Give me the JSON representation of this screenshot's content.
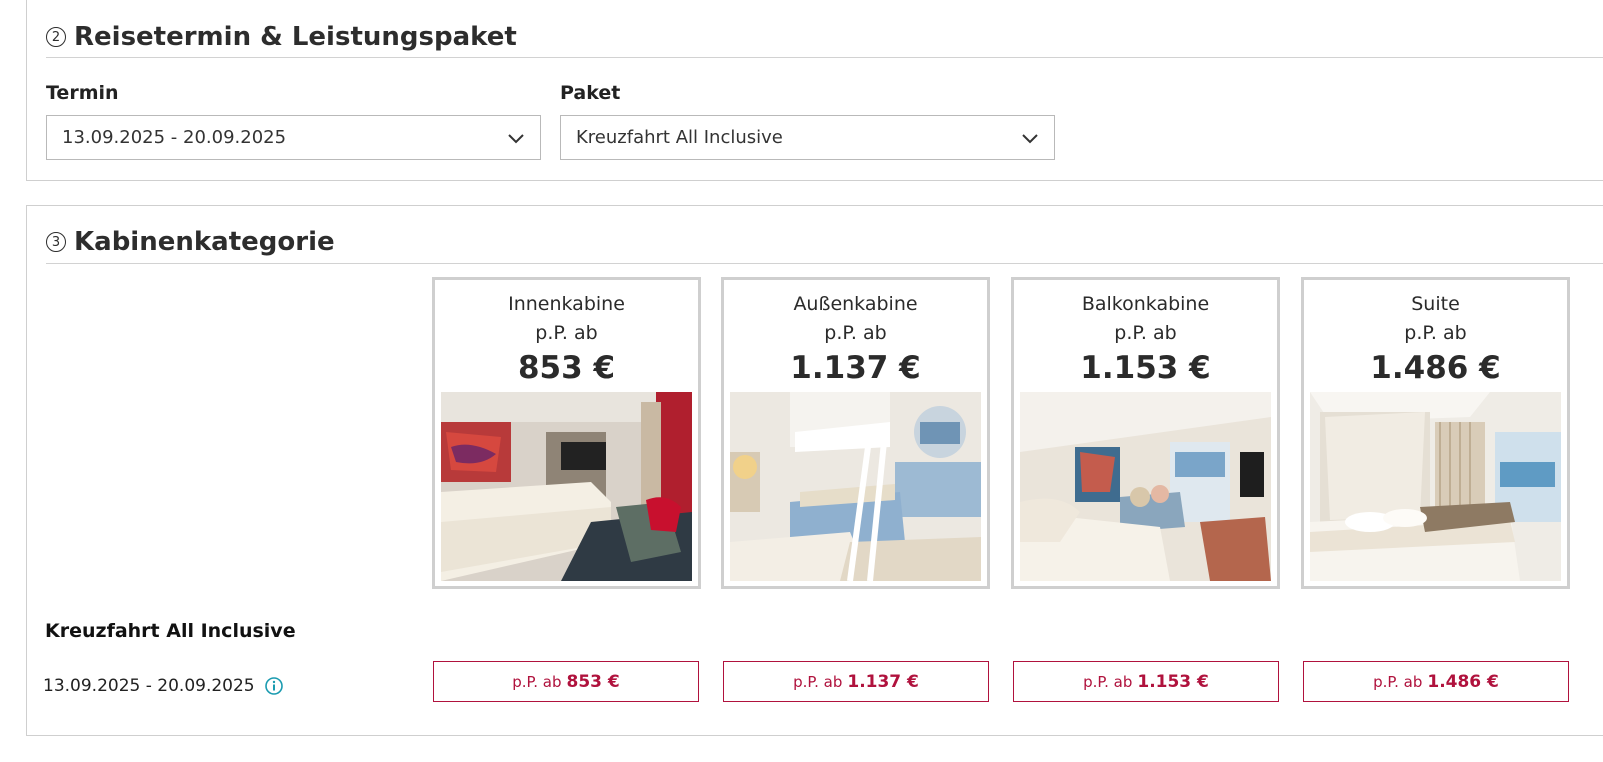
{
  "travel_section": {
    "number": "2",
    "title": "Reisetermin & Leistungspaket",
    "termin_label": "Termin",
    "termin_value": "13.09.2025 - 20.09.2025",
    "paket_label": "Paket",
    "paket_value": "Kreuzfahrt All Inclusive"
  },
  "cabin_section": {
    "number": "3",
    "title": "Kabinenkategorie",
    "cabins": [
      {
        "name": "Innenkabine",
        "from": "p.P. ab",
        "price": "853 €"
      },
      {
        "name": "Außenkabine",
        "from": "p.P. ab",
        "price": "1.137 €"
      },
      {
        "name": "Balkonkabine",
        "from": "p.P. ab",
        "price": "1.153 €"
      },
      {
        "name": "Suite",
        "from": "p.P. ab",
        "price": "1.486 €"
      }
    ],
    "package_name": "Kreuzfahrt All Inclusive",
    "date_range": "13.09.2025 - 20.09.2025",
    "price_buttons": [
      {
        "prefix": "p.P. ab",
        "price": "853 €"
      },
      {
        "prefix": "p.P. ab",
        "price": "1.137 €"
      },
      {
        "prefix": "p.P. ab",
        "price": "1.153 €"
      },
      {
        "prefix": "p.P. ab",
        "price": "1.486 €"
      }
    ]
  },
  "colors": {
    "accent": "#b0123d",
    "info": "#1a9bb0",
    "border": "#cfcfcf"
  },
  "icons": [
    "chevron-down-icon",
    "info-icon",
    "circled-number-icon"
  ]
}
